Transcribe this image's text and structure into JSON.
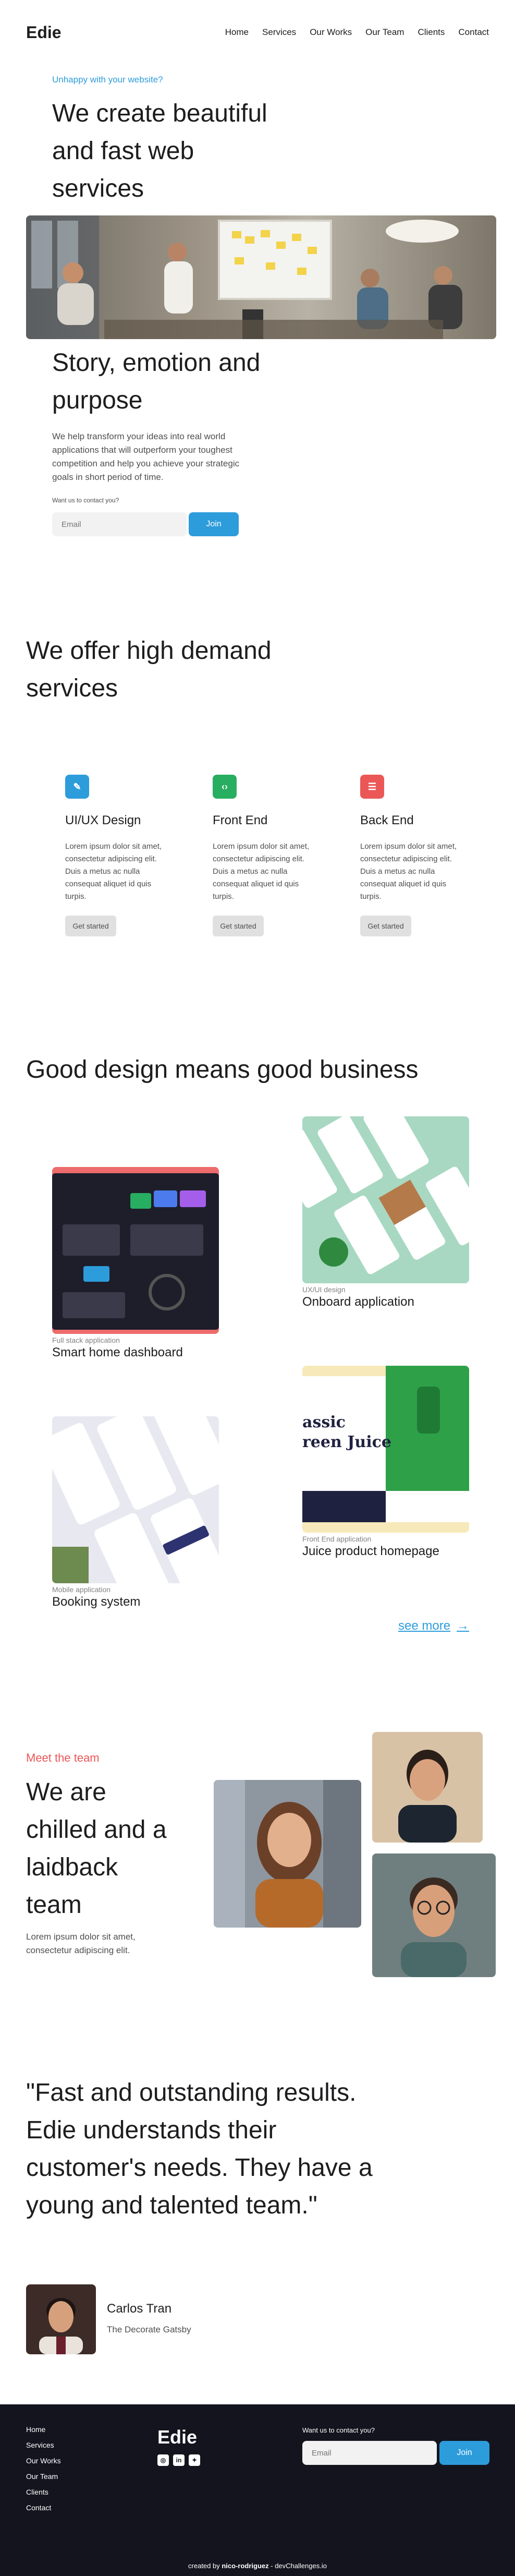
{
  "header": {
    "logo": "Edie",
    "nav": [
      "Home",
      "Services",
      "Our Works",
      "Our Team",
      "Clients",
      "Contact"
    ]
  },
  "hero": {
    "eyebrow": "Unhappy with your website?",
    "title": "We create beautiful and fast web services",
    "story_title": "Story, emotion and purpose",
    "story_text": "We help transform your ideas into real world applications that will outperform your toughest competition and help you achieve your strategic goals in short period of time.",
    "contact_label": "Want us to contact you?",
    "email_placeholder": "Email",
    "join_label": "Join"
  },
  "services": {
    "title": "We offer high demand services",
    "items": [
      {
        "title": "UI/UX Design",
        "icon": "pencil-icon",
        "icon_glyph": "✎",
        "color": "#2d9cdb",
        "text": "Lorem ipsum dolor sit amet, consectetur adipiscing elit. Duis a metus ac nulla consequat aliquet id quis turpis.",
        "button": "Get started"
      },
      {
        "title": "Front End",
        "icon": "code-icon",
        "icon_glyph": "‹›",
        "color": "#27ae60",
        "text": "Lorem ipsum dolor sit amet, consectetur adipiscing elit. Duis a metus ac nulla consequat aliquet id quis turpis.",
        "button": "Get started"
      },
      {
        "title": "Back End",
        "icon": "list-icon",
        "icon_glyph": "☰",
        "color": "#eb5757",
        "text": "Lorem ipsum dolor sit amet, consectetur adipiscing elit. Duis a metus ac nulla consequat aliquet id quis turpis.",
        "button": "Get started"
      }
    ]
  },
  "works": {
    "title": "Good design means good business",
    "items": [
      {
        "category": "Full stack application",
        "name": "Smart home dashboard"
      },
      {
        "category": "UX/UI design",
        "name": "Onboard application"
      },
      {
        "category": "Mobile application",
        "name": "Booking system"
      },
      {
        "category": "Front End application",
        "name": "Juice product homepage"
      }
    ],
    "juice_overlay": "assic\nreen Juice",
    "see_more": "see more",
    "see_more_icon": "arrow-right-icon"
  },
  "team": {
    "eyebrow": "Meet the team",
    "title": "We are chilled and a laidback team",
    "text": "Lorem ipsum dolor sit amet, consectetur adipiscing elit."
  },
  "testimonial": {
    "quote": "\"Fast and outstanding results. Edie understands their customer's needs. They have a young and talented team.\"",
    "author": "Carlos Tran",
    "company": "The Decorate Gatsby"
  },
  "footer": {
    "links": [
      "Home",
      "Services",
      "Our Works",
      "Our Team",
      "Clients",
      "Contact"
    ],
    "logo": "Edie",
    "social": [
      "instagram-icon",
      "linkedin-icon",
      "twitter-icon"
    ],
    "contact_label": "Want us to contact you?",
    "email_placeholder": "Email",
    "join_label": "Join",
    "credit_prefix": "created by",
    "credit_author": "nico-rodriguez",
    "credit_suffix": "- devChallenges.io"
  },
  "colors": {
    "accent": "#2d9cdb",
    "red": "#eb5757",
    "green": "#27ae60",
    "footer_bg": "#14141f"
  }
}
